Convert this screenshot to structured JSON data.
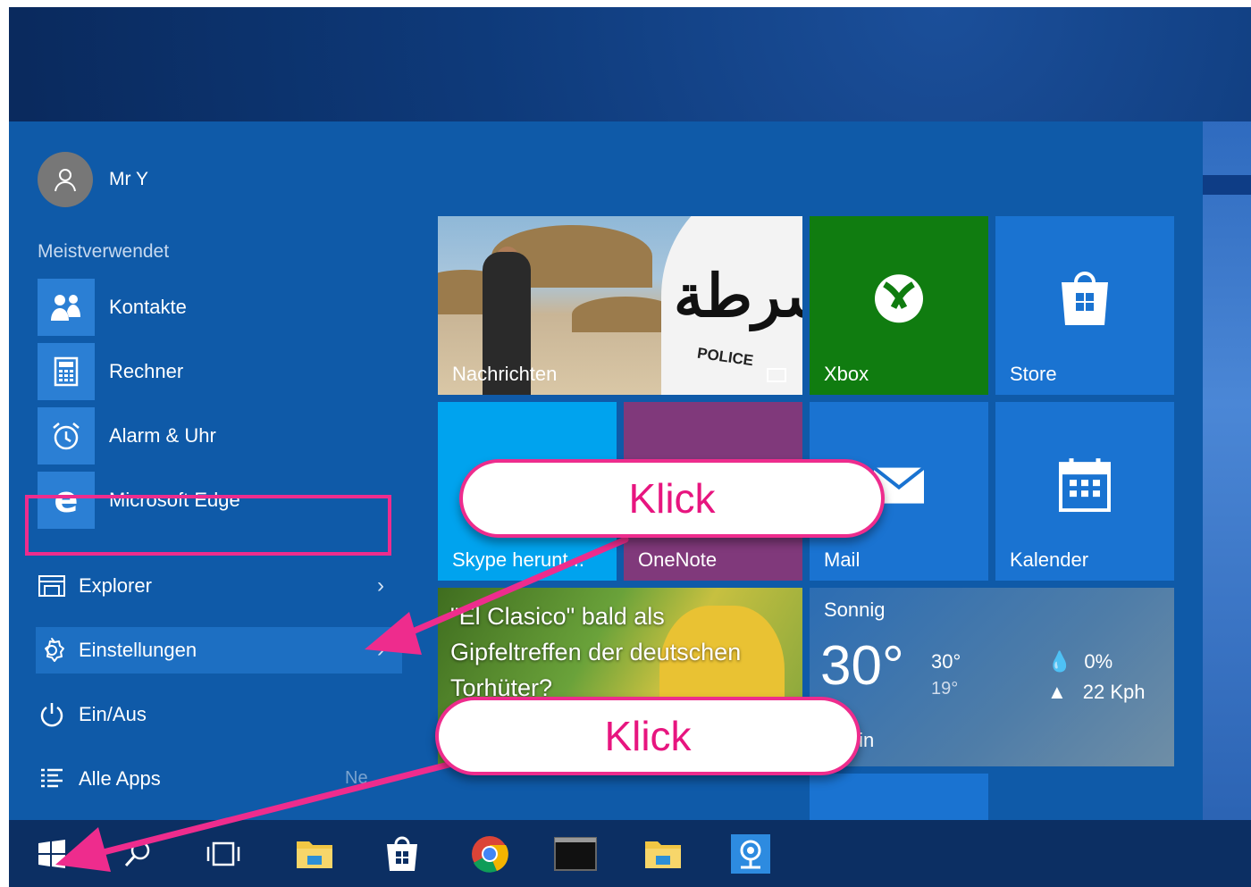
{
  "user": {
    "name": "Mr Y",
    "avatar_icon": "person-icon"
  },
  "most_used": {
    "label": "Meistverwendet",
    "items": [
      {
        "label": "Kontakte",
        "icon": "contacts-icon"
      },
      {
        "label": "Rechner",
        "icon": "calculator-icon"
      },
      {
        "label": "Alarm & Uhr",
        "icon": "alarm-clock-icon"
      },
      {
        "label": "Microsoft Edge",
        "icon": "edge-icon"
      }
    ]
  },
  "nav": {
    "explorer": "Explorer",
    "settings": "Einstellungen",
    "power": "Ein/Aus",
    "all_apps": "Alle Apps",
    "all_apps_hint": "Ne"
  },
  "tiles": {
    "news": "Nachrichten",
    "xbox": "Xbox",
    "store": "Store",
    "skype": "Skype herunt...",
    "onenote": "OneNote",
    "mail": "Mail",
    "kalender": "Kalender",
    "sport_headline": "\"El Clasico\" bald als Gipfeltreffen der deutschen Torhüter?"
  },
  "weather": {
    "condition": "Sonnig",
    "temp": "30°",
    "high": "30°",
    "low": "19°",
    "precip": "0%",
    "wind": "22 Kph",
    "location": "Berlin"
  },
  "news_image_text": {
    "arabic": "شرطة",
    "police": "POLICE"
  },
  "callouts": {
    "first": "Klick",
    "second": "Klick"
  },
  "colors": {
    "start_menu": "#0f5aa8",
    "tile_blue": "#1a73d1",
    "xbox_green": "#107c10",
    "onenote_purple": "#80397b",
    "skype_blue": "#00a3ee",
    "annotation_pink": "#ee2c8d"
  },
  "taskbar": [
    "windows-start-icon",
    "search-icon",
    "task-view-icon",
    "file-explorer-icon",
    "store-icon",
    "chrome-icon",
    "terminal-icon",
    "folder-icon",
    "webcam-app-icon"
  ]
}
